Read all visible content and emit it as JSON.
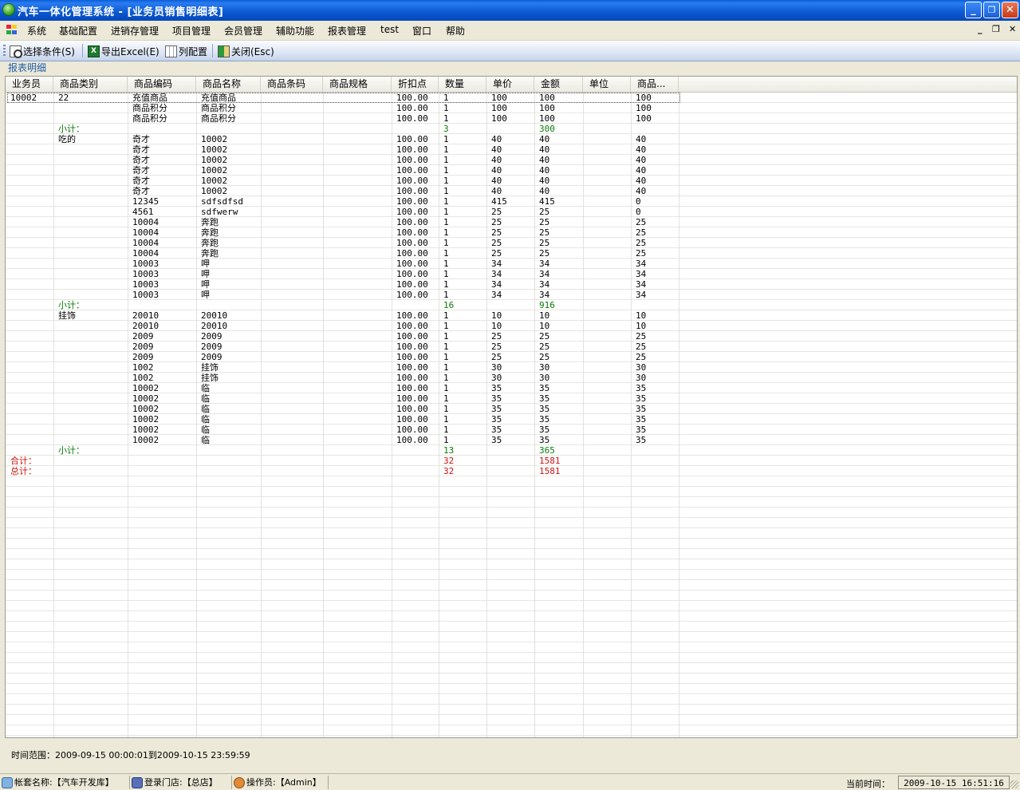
{
  "window": {
    "title": "汽车一体化管理系统 - [业务员销售明细表]",
    "minimize_icon": "minimize-icon",
    "restore_icon": "restore-icon",
    "close_icon": "close-icon"
  },
  "menu": {
    "items": [
      "系统",
      "基础配置",
      "进销存管理",
      "项目管理",
      "会员管理",
      "辅助功能",
      "报表管理",
      "test",
      "窗口",
      "帮助"
    ]
  },
  "toolbar": {
    "select_label": "选择条件(S)",
    "export_label": "导出Excel(E)",
    "columns_label": "列配置",
    "close_label": "关闭(Esc)"
  },
  "panel": {
    "title": "报表明细"
  },
  "grid": {
    "columns": [
      "业务员",
      "商品类别",
      "商品编码",
      "商品名称",
      "商品条码",
      "商品规格",
      "折扣点",
      "数量",
      "单价",
      "金额",
      "单位",
      "商品..."
    ],
    "rows": [
      {
        "type": "data",
        "cells": [
          "10002",
          "22",
          "充值商品",
          "充值商品",
          "",
          "",
          "100.00",
          "1",
          "100",
          "100",
          "",
          "100"
        ]
      },
      {
        "type": "data",
        "cells": [
          "",
          "",
          "商品积分",
          "商品积分",
          "",
          "",
          "100.00",
          "1",
          "100",
          "100",
          "",
          "100"
        ]
      },
      {
        "type": "data",
        "cells": [
          "",
          "",
          "商品积分",
          "商品积分",
          "",
          "",
          "100.00",
          "1",
          "100",
          "100",
          "",
          "100"
        ]
      },
      {
        "type": "sub",
        "cells": [
          "",
          "小计：",
          "",
          "",
          "",
          "",
          "",
          "3",
          "",
          "300",
          "",
          ""
        ]
      },
      {
        "type": "data",
        "cells": [
          "",
          "吃的",
          "奇才",
          "10002",
          "",
          "",
          "100.00",
          "1",
          "40",
          "40",
          "",
          "40"
        ]
      },
      {
        "type": "data",
        "cells": [
          "",
          "",
          "奇才",
          "10002",
          "",
          "",
          "100.00",
          "1",
          "40",
          "40",
          "",
          "40"
        ]
      },
      {
        "type": "data",
        "cells": [
          "",
          "",
          "奇才",
          "10002",
          "",
          "",
          "100.00",
          "1",
          "40",
          "40",
          "",
          "40"
        ]
      },
      {
        "type": "data",
        "cells": [
          "",
          "",
          "奇才",
          "10002",
          "",
          "",
          "100.00",
          "1",
          "40",
          "40",
          "",
          "40"
        ]
      },
      {
        "type": "data",
        "cells": [
          "",
          "",
          "奇才",
          "10002",
          "",
          "",
          "100.00",
          "1",
          "40",
          "40",
          "",
          "40"
        ]
      },
      {
        "type": "data",
        "cells": [
          "",
          "",
          "奇才",
          "10002",
          "",
          "",
          "100.00",
          "1",
          "40",
          "40",
          "",
          "40"
        ]
      },
      {
        "type": "data",
        "cells": [
          "",
          "",
          "12345",
          "sdfsdfsd",
          "",
          "",
          "100.00",
          "1",
          "415",
          "415",
          "",
          "0"
        ]
      },
      {
        "type": "data",
        "cells": [
          "",
          "",
          "4561",
          "sdfwerw",
          "",
          "",
          "100.00",
          "1",
          "25",
          "25",
          "",
          "0"
        ]
      },
      {
        "type": "data",
        "cells": [
          "",
          "",
          "10004",
          "奔跑",
          "",
          "",
          "100.00",
          "1",
          "25",
          "25",
          "",
          "25"
        ]
      },
      {
        "type": "data",
        "cells": [
          "",
          "",
          "10004",
          "奔跑",
          "",
          "",
          "100.00",
          "1",
          "25",
          "25",
          "",
          "25"
        ]
      },
      {
        "type": "data",
        "cells": [
          "",
          "",
          "10004",
          "奔跑",
          "",
          "",
          "100.00",
          "1",
          "25",
          "25",
          "",
          "25"
        ]
      },
      {
        "type": "data",
        "cells": [
          "",
          "",
          "10004",
          "奔跑",
          "",
          "",
          "100.00",
          "1",
          "25",
          "25",
          "",
          "25"
        ]
      },
      {
        "type": "data",
        "cells": [
          "",
          "",
          "10003",
          "呷",
          "",
          "",
          "100.00",
          "1",
          "34",
          "34",
          "",
          "34"
        ]
      },
      {
        "type": "data",
        "cells": [
          "",
          "",
          "10003",
          "呷",
          "",
          "",
          "100.00",
          "1",
          "34",
          "34",
          "",
          "34"
        ]
      },
      {
        "type": "data",
        "cells": [
          "",
          "",
          "10003",
          "呷",
          "",
          "",
          "100.00",
          "1",
          "34",
          "34",
          "",
          "34"
        ]
      },
      {
        "type": "data",
        "cells": [
          "",
          "",
          "10003",
          "呷",
          "",
          "",
          "100.00",
          "1",
          "34",
          "34",
          "",
          "34"
        ]
      },
      {
        "type": "sub",
        "cells": [
          "",
          "小计：",
          "",
          "",
          "",
          "",
          "",
          "16",
          "",
          "916",
          "",
          ""
        ]
      },
      {
        "type": "data",
        "cells": [
          "",
          "挂饰",
          "20010",
          "20010",
          "",
          "",
          "100.00",
          "1",
          "10",
          "10",
          "",
          "10"
        ]
      },
      {
        "type": "data",
        "cells": [
          "",
          "",
          "20010",
          "20010",
          "",
          "",
          "100.00",
          "1",
          "10",
          "10",
          "",
          "10"
        ]
      },
      {
        "type": "data",
        "cells": [
          "",
          "",
          "2009",
          "2009",
          "",
          "",
          "100.00",
          "1",
          "25",
          "25",
          "",
          "25"
        ]
      },
      {
        "type": "data",
        "cells": [
          "",
          "",
          "2009",
          "2009",
          "",
          "",
          "100.00",
          "1",
          "25",
          "25",
          "",
          "25"
        ]
      },
      {
        "type": "data",
        "cells": [
          "",
          "",
          "2009",
          "2009",
          "",
          "",
          "100.00",
          "1",
          "25",
          "25",
          "",
          "25"
        ]
      },
      {
        "type": "data",
        "cells": [
          "",
          "",
          "1002",
          "挂饰",
          "",
          "",
          "100.00",
          "1",
          "30",
          "30",
          "",
          "30"
        ]
      },
      {
        "type": "data",
        "cells": [
          "",
          "",
          "1002",
          "挂饰",
          "",
          "",
          "100.00",
          "1",
          "30",
          "30",
          "",
          "30"
        ]
      },
      {
        "type": "data",
        "cells": [
          "",
          "",
          "10002",
          "临",
          "",
          "",
          "100.00",
          "1",
          "35",
          "35",
          "",
          "35"
        ]
      },
      {
        "type": "data",
        "cells": [
          "",
          "",
          "10002",
          "临",
          "",
          "",
          "100.00",
          "1",
          "35",
          "35",
          "",
          "35"
        ]
      },
      {
        "type": "data",
        "cells": [
          "",
          "",
          "10002",
          "临",
          "",
          "",
          "100.00",
          "1",
          "35",
          "35",
          "",
          "35"
        ]
      },
      {
        "type": "data",
        "cells": [
          "",
          "",
          "10002",
          "临",
          "",
          "",
          "100.00",
          "1",
          "35",
          "35",
          "",
          "35"
        ]
      },
      {
        "type": "data",
        "cells": [
          "",
          "",
          "10002",
          "临",
          "",
          "",
          "100.00",
          "1",
          "35",
          "35",
          "",
          "35"
        ]
      },
      {
        "type": "data",
        "cells": [
          "",
          "",
          "10002",
          "临",
          "",
          "",
          "100.00",
          "1",
          "35",
          "35",
          "",
          "35"
        ]
      },
      {
        "type": "sub",
        "cells": [
          "",
          "小计：",
          "",
          "",
          "",
          "",
          "",
          "13",
          "",
          "365",
          "",
          ""
        ]
      },
      {
        "type": "tot",
        "cells": [
          "合计：",
          "",
          "",
          "",
          "",
          "",
          "",
          "32",
          "",
          "1581",
          "",
          ""
        ]
      },
      {
        "type": "tot",
        "cells": [
          "总计：",
          "",
          "",
          "",
          "",
          "",
          "",
          "32",
          "",
          "1581",
          "",
          ""
        ]
      }
    ]
  },
  "footer": {
    "time_range": "时间范围：2009-09-15 00:00:01到2009-10-15 23:59:59"
  },
  "statusbar": {
    "account": "帐套名称:【汽车开发库】",
    "store": "登录门店:【总店】",
    "operator": "操作员:【Admin】",
    "current_time_label": "当前时间：",
    "current_time": "2009-10-15 16:51:16"
  },
  "colors": {
    "subtotal": "#0a7a0a",
    "total": "#d01010",
    "titlebar": "#0a58d2"
  }
}
